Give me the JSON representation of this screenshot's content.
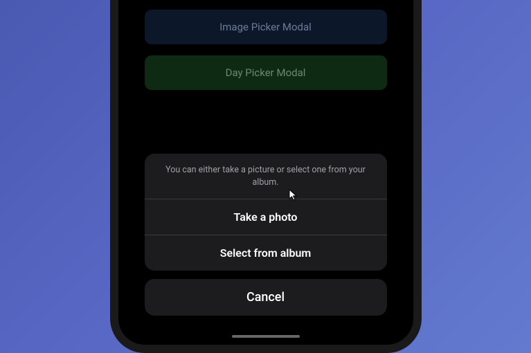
{
  "background": {
    "button1_label": "Image Picker Modal",
    "button2_label": "Day Picker Modal"
  },
  "action_sheet": {
    "title": "You can either take a picture or select one from your album.",
    "option1_label": "Take a photo",
    "option2_label": "Select from album",
    "cancel_label": "Cancel"
  }
}
